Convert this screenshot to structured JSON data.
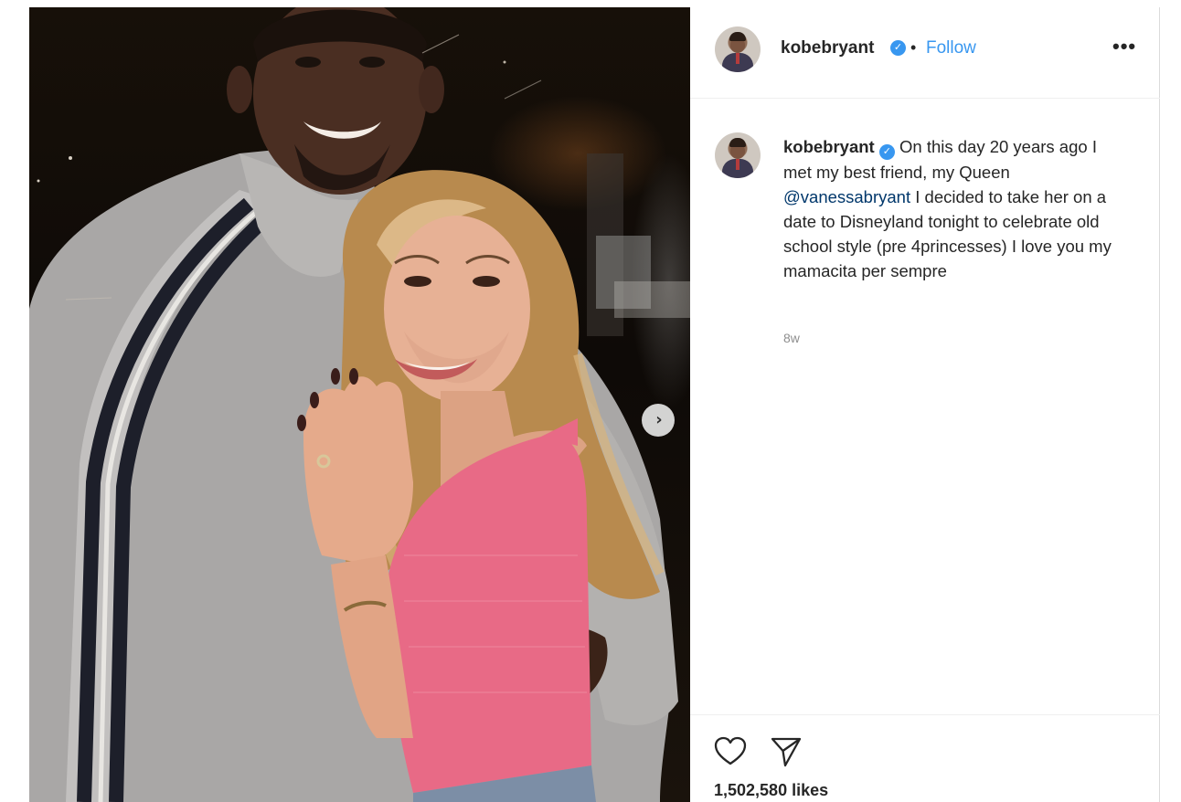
{
  "post": {
    "username": "kobebryant",
    "verified_mark": "✓",
    "separator": "•",
    "follow_label": "Follow",
    "more_label": "•••",
    "carousel_next_label": "›"
  },
  "caption": {
    "username": "kobebryant",
    "text_before_mention": "On this day 20 years ago I met my best friend, my Queen ",
    "mention": "@vanessabryant",
    "text_after_mention": " I decided to take her on a date to Disneyland tonight to celebrate old school style (pre 4princesses) I love you my mamacita per sempre",
    "time_ago": "8w"
  },
  "actions": {
    "like_icon": "heart-icon",
    "share_icon": "paper-plane-icon",
    "likes_text": "1,502,580 likes"
  },
  "colors": {
    "link_blue": "#3897f0",
    "mention_blue": "#00376b",
    "text": "#262626",
    "muted": "#8e8e8e",
    "border": "#efefef"
  }
}
